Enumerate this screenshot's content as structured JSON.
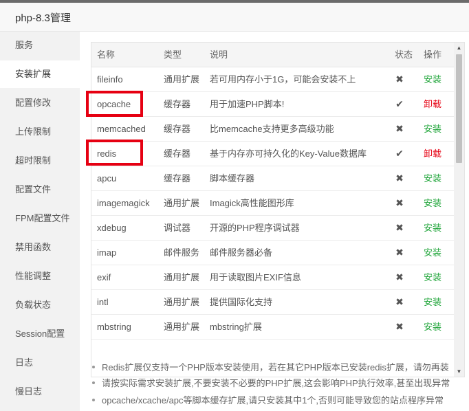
{
  "window": {
    "title": "php-8.3管理"
  },
  "sidebar": {
    "items": [
      {
        "label": "服务"
      },
      {
        "label": "安装扩展"
      },
      {
        "label": "配置修改"
      },
      {
        "label": "上传限制"
      },
      {
        "label": "超时限制"
      },
      {
        "label": "配置文件"
      },
      {
        "label": "FPM配置文件"
      },
      {
        "label": "禁用函数"
      },
      {
        "label": "性能调整"
      },
      {
        "label": "负载状态"
      },
      {
        "label": "Session配置"
      },
      {
        "label": "日志"
      },
      {
        "label": "慢日志"
      }
    ],
    "active_index": 1
  },
  "table": {
    "headers": {
      "name": "名称",
      "type": "类型",
      "desc": "说明",
      "status": "状态",
      "action": "操作"
    },
    "rows": [
      {
        "name": "fileinfo",
        "type": "通用扩展",
        "desc": "若可用内存小于1G，可能会安装不上",
        "status": "✖",
        "status_icon": "cross-icon",
        "action": "安装",
        "installed": false
      },
      {
        "name": "opcache",
        "type": "缓存器",
        "desc": "用于加速PHP脚本!",
        "status": "✔",
        "status_icon": "check-icon",
        "action": "卸载",
        "installed": true
      },
      {
        "name": "memcached",
        "type": "缓存器",
        "desc": "比memcache支持更多高级功能",
        "status": "✖",
        "status_icon": "cross-icon",
        "action": "安装",
        "installed": false
      },
      {
        "name": "redis",
        "type": "缓存器",
        "desc": "基于内存亦可持久化的Key-Value数据库",
        "status": "✔",
        "status_icon": "check-icon",
        "action": "卸载",
        "installed": true
      },
      {
        "name": "apcu",
        "type": "缓存器",
        "desc": "脚本缓存器",
        "status": "✖",
        "status_icon": "cross-icon",
        "action": "安装",
        "installed": false
      },
      {
        "name": "imagemagick",
        "type": "通用扩展",
        "desc": "Imagick高性能图形库",
        "status": "✖",
        "status_icon": "cross-icon",
        "action": "安装",
        "installed": false
      },
      {
        "name": "xdebug",
        "type": "调试器",
        "desc": "开源的PHP程序调试器",
        "status": "✖",
        "status_icon": "cross-icon",
        "action": "安装",
        "installed": false
      },
      {
        "name": "imap",
        "type": "邮件服务",
        "desc": "邮件服务器必备",
        "status": "✖",
        "status_icon": "cross-icon",
        "action": "安装",
        "installed": false
      },
      {
        "name": "exif",
        "type": "通用扩展",
        "desc": "用于读取图片EXIF信息",
        "status": "✖",
        "status_icon": "cross-icon",
        "action": "安装",
        "installed": false
      },
      {
        "name": "intl",
        "type": "通用扩展",
        "desc": "提供国际化支持",
        "status": "✖",
        "status_icon": "cross-icon",
        "action": "安装",
        "installed": false
      },
      {
        "name": "mbstring",
        "type": "通用扩展",
        "desc": "mbstring扩展",
        "status": "✖",
        "status_icon": "cross-icon",
        "action": "安装",
        "installed": false
      }
    ],
    "highlighted_rows": [
      "opcache",
      "redis"
    ]
  },
  "scrollbar": {
    "up_icon": "▲",
    "down_icon": "▼"
  },
  "notes": [
    "Redis扩展仅支持一个PHP版本安装使用，若在其它PHP版本已安装redis扩展，请勿再装",
    "请按实际需求安装扩展,不要安装不必要的PHP扩展,这会影响PHP执行效率,甚至出现异常",
    "opcache/xcache/apc等脚本缓存扩展,请只安装其中1个,否则可能导致您的站点程序异常"
  ],
  "colors": {
    "install": "#20a53a",
    "uninstall": "#e60012",
    "highlight_box": "#e60012"
  }
}
